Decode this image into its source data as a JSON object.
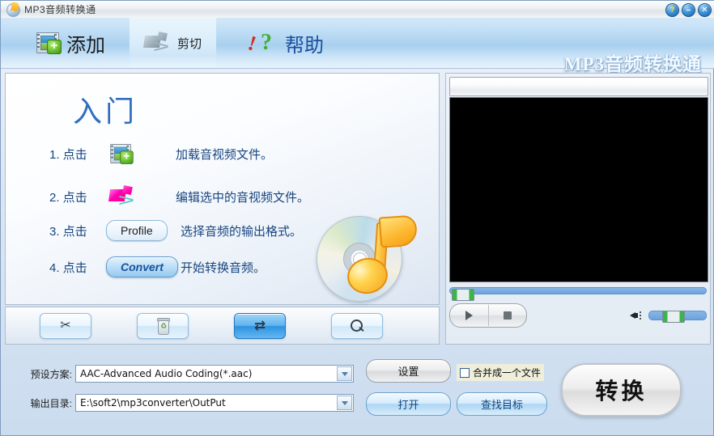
{
  "window": {
    "title": "MP3音频转换通",
    "icon": "app-disc-note-icon",
    "controls": {
      "help": "?",
      "minimize": "–",
      "close": "✕"
    }
  },
  "toolbar": {
    "add_label": "添加",
    "cut_label": "剪切",
    "help_label": "帮助",
    "brand": "MP3音频转换通"
  },
  "getting_started": {
    "heading": "入门",
    "steps": [
      {
        "num": "1. 点击",
        "control": "add-icon",
        "desc": "加载音视频文件。"
      },
      {
        "num": "2. 点击",
        "control": "cut-icon",
        "desc": "编辑选中的音视频文件。"
      },
      {
        "num": "3. 点击",
        "control": "Profile",
        "desc": "选择音频的输出格式。"
      },
      {
        "num": "4. 点击",
        "control": "Convert",
        "desc": "开始转换音频。"
      }
    ],
    "profile_button": "Profile",
    "convert_button": "Convert"
  },
  "action_bar": {
    "buttons": [
      {
        "icon": "scissors-icon",
        "active": false
      },
      {
        "icon": "trash-icon",
        "active": false
      },
      {
        "icon": "convert-arrows-icon",
        "active": true
      },
      {
        "icon": "search-icon",
        "active": false
      }
    ]
  },
  "preview": {
    "title_strip": "",
    "seek_value": "0",
    "volume_value": "20",
    "play_icon": "play-icon",
    "stop_icon": "stop-icon",
    "speaker_icon": "speaker-icon"
  },
  "settings": {
    "preset_label": "预设方案:",
    "preset_value": "AAC-Advanced Audio Coding(*.aac)",
    "output_label": "输出目录:",
    "output_value": "E:\\soft2\\mp3converter\\OutPut",
    "setting_button": "设置",
    "open_button": "打开",
    "find_button": "查找目标",
    "merge_checkbox_label": "合并成一个文件",
    "merge_checked": false,
    "convert_button": "转换"
  },
  "colors": {
    "accent_blue": "#2f6fbe",
    "toolbar_blue": "#a8d0ef",
    "panel_border": "#aebdce",
    "help_text": "#1a4fa0",
    "video_background": "#000000"
  }
}
